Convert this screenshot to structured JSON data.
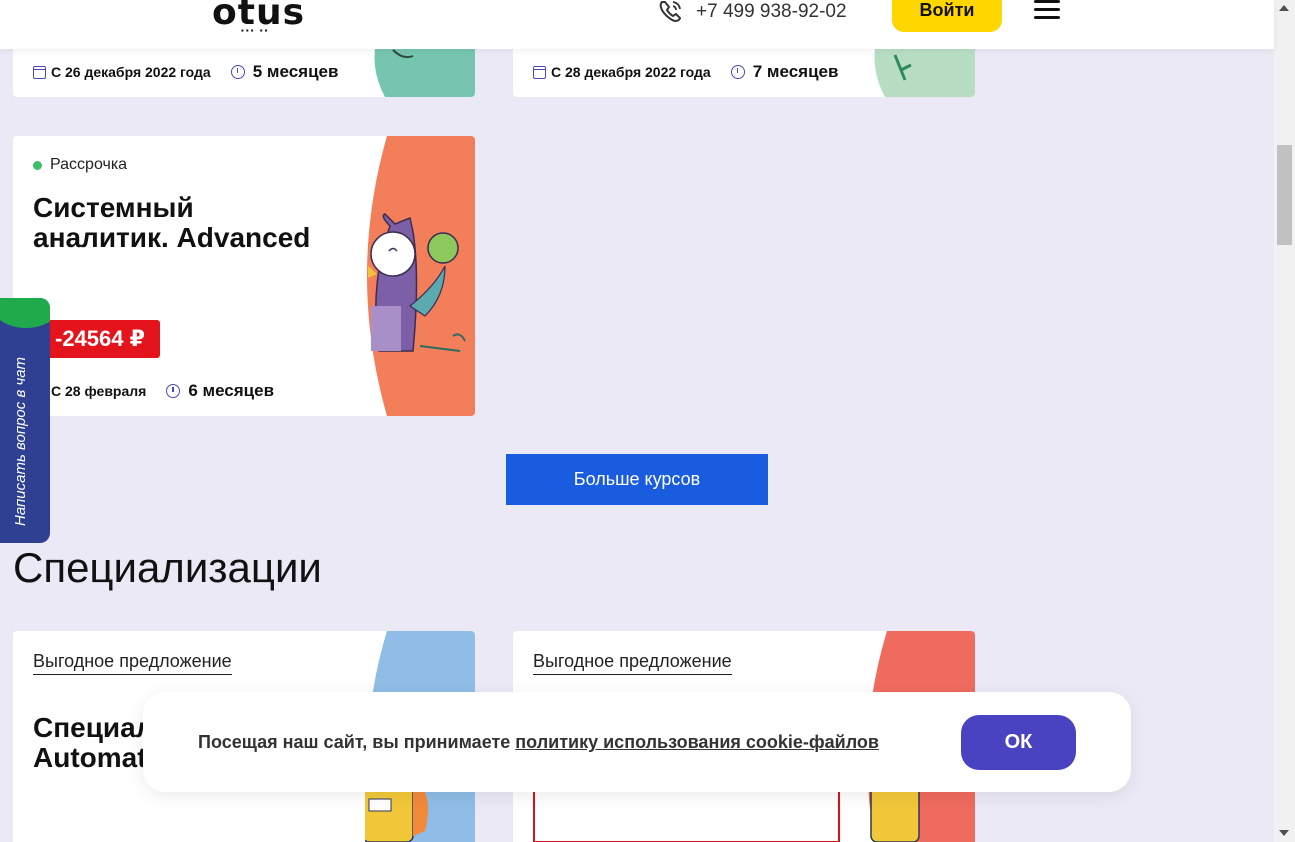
{
  "header": {
    "logo": "otus",
    "phone": "+7 499 938-92-02",
    "login_label": "Войти"
  },
  "top_cards": [
    {
      "start": "С 26 декабря 2022 года",
      "duration": "5 месяцев",
      "art_color": "#76c5b1"
    },
    {
      "start": "С 28 декабря 2022 года",
      "duration": "7 месяцев",
      "art_color": "#b7dec3"
    }
  ],
  "course_card": {
    "tag": "Рассрочка",
    "title_line1": "Системный",
    "title_line2": "аналитик. Advanced",
    "price": "-24564 ₽",
    "start": "С 28 февраля",
    "duration": "6 месяцев",
    "art_color": "#f27e5a"
  },
  "more_button": "Больше курсов",
  "section_title": "Специализации",
  "spec_cards": [
    {
      "offer": "Выгодное предложение",
      "title_line1": "Специал",
      "title_line2": "Automat",
      "art_color": "#8fbde6"
    },
    {
      "offer": "Выгодное предложение",
      "art_color": "#ef6b5e"
    }
  ],
  "chat_tab": "Написать вопрос в чат",
  "cookie": {
    "text": "Посещая наш сайт, вы принимаете ",
    "link": "политику использования cookie-файлов",
    "ok": "ОК"
  },
  "colors": {
    "accent_yellow": "#ffd600",
    "primary_blue": "#1a5ce0",
    "ok_purple": "#4a43c1",
    "price_red": "#e3141c"
  }
}
